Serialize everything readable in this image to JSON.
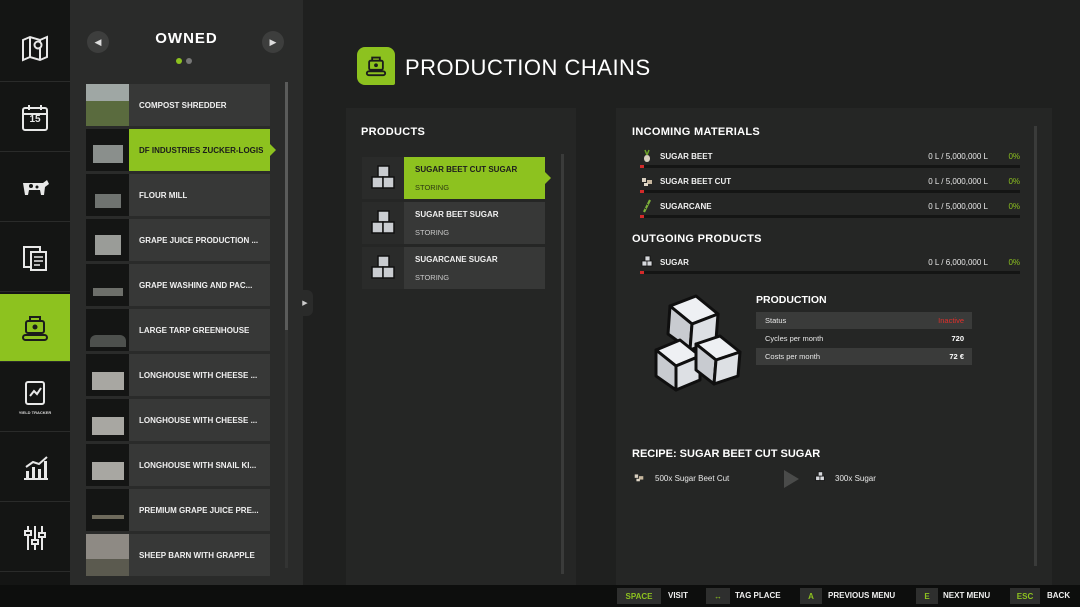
{
  "rail": {
    "items": [
      {
        "icon": "map-icon"
      },
      {
        "icon": "calendar-icon",
        "day": "15"
      },
      {
        "icon": "animals-icon"
      },
      {
        "icon": "contracts-icon"
      },
      {
        "icon": "production-icon"
      },
      {
        "icon": "yield-tracker-icon",
        "caption": "YIELD TRACKER"
      },
      {
        "icon": "statistics-icon"
      },
      {
        "icon": "settings-icon"
      }
    ]
  },
  "owned": {
    "title": "OWNED",
    "items": [
      {
        "name": "COMPOST SHREDDER"
      },
      {
        "name": "DF INDUSTRIES ZUCKER-LOGIS"
      },
      {
        "name": "FLOUR MILL"
      },
      {
        "name": "GRAPE JUICE PRODUCTION ..."
      },
      {
        "name": "GRAPE WASHING AND PAC..."
      },
      {
        "name": "LARGE TARP GREENHOUSE"
      },
      {
        "name": "LONGHOUSE WITH CHEESE ..."
      },
      {
        "name": "LONGHOUSE WITH CHEESE ..."
      },
      {
        "name": "LONGHOUSE WITH SNAIL KI..."
      },
      {
        "name": "PREMIUM GRAPE JUICE PRE..."
      },
      {
        "name": "SHEEP BARN WITH GRAPPLE"
      }
    ]
  },
  "page": {
    "title": "PRODUCTION CHAINS"
  },
  "products": {
    "title": "PRODUCTS",
    "items": [
      {
        "name": "SUGAR BEET CUT SUGAR",
        "mode": "STORING"
      },
      {
        "name": "SUGAR BEET SUGAR",
        "mode": "STORING"
      },
      {
        "name": "SUGARCANE SUGAR",
        "mode": "STORING"
      }
    ]
  },
  "incoming": {
    "title": "INCOMING MATERIALS",
    "items": [
      {
        "name": "SUGAR BEET",
        "qty": "0 L / 5,000,000 L",
        "pct": "0%",
        "fill": 0
      },
      {
        "name": "SUGAR BEET CUT",
        "qty": "0 L / 5,000,000 L",
        "pct": "0%",
        "fill": 0
      },
      {
        "name": "SUGARCANE",
        "qty": "0 L / 5,000,000 L",
        "pct": "0%",
        "fill": 0
      }
    ]
  },
  "outgoing": {
    "title": "OUTGOING PRODUCTS",
    "items": [
      {
        "name": "SUGAR",
        "qty": "0 L / 6,000,000 L",
        "pct": "0%",
        "fill": 0
      }
    ]
  },
  "production": {
    "title": "PRODUCTION",
    "status_label": "Status",
    "status_value": "Inactive",
    "cycles_label": "Cycles per month",
    "cycles_value": "720",
    "costs_label": "Costs per month",
    "costs_value": "72 €"
  },
  "recipe": {
    "title": "RECIPE: SUGAR BEET CUT SUGAR",
    "input": "500x Sugar Beet Cut",
    "output": "300x Sugar"
  },
  "footer": {
    "visit_key": "SPACE",
    "visit_label": "VISIT",
    "tag_key": "↔",
    "tag_label": "TAG PLACE",
    "prev_key": "A",
    "prev_label": "PREVIOUS MENU",
    "next_key": "E",
    "next_label": "NEXT MENU",
    "back_key": "ESC",
    "back_label": "BACK"
  },
  "colors": {
    "accent": "#8dc21f",
    "danger": "#e0302b",
    "panel": "#252625"
  }
}
